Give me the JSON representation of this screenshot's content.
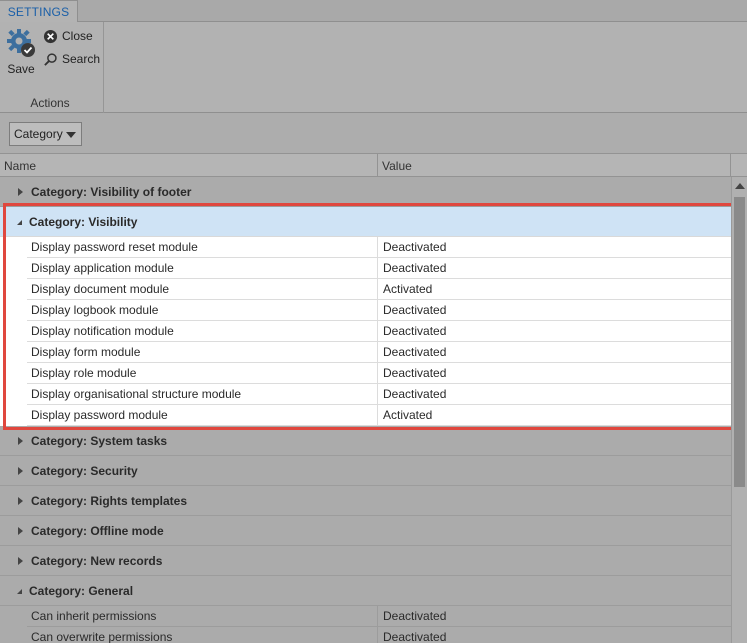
{
  "ribbon": {
    "tab_label": "SETTINGS",
    "save_label": "Save",
    "close_label": "Close",
    "search_label": "Search",
    "group_label": "Actions"
  },
  "filter": {
    "selected": "Category"
  },
  "grid": {
    "columns": {
      "name": "Name",
      "value": "Value"
    },
    "categories": [
      {
        "label": "Category: Visibility of footer",
        "expanded": false
      },
      {
        "label": "Category: Visibility",
        "expanded": true,
        "rows": [
          {
            "name": "Display password reset module",
            "value": "Deactivated"
          },
          {
            "name": "Display application module",
            "value": "Deactivated"
          },
          {
            "name": "Display document module",
            "value": "Activated"
          },
          {
            "name": "Display logbook module",
            "value": "Deactivated"
          },
          {
            "name": "Display notification module",
            "value": "Deactivated"
          },
          {
            "name": "Display form module",
            "value": "Deactivated"
          },
          {
            "name": "Display role module",
            "value": "Deactivated"
          },
          {
            "name": "Display organisational structure module",
            "value": "Deactivated"
          },
          {
            "name": "Display password module",
            "value": "Activated"
          }
        ]
      },
      {
        "label": "Category: System tasks",
        "expanded": false
      },
      {
        "label": "Category: Security",
        "expanded": false
      },
      {
        "label": "Category: Rights templates",
        "expanded": false
      },
      {
        "label": "Category: Offline mode",
        "expanded": false
      },
      {
        "label": "Category: New records",
        "expanded": false
      },
      {
        "label": "Category: General",
        "expanded": true,
        "rows": [
          {
            "name": "Can inherit permissions",
            "value": "Deactivated"
          },
          {
            "name": "Can overwrite permissions",
            "value": "Deactivated"
          }
        ]
      }
    ]
  },
  "colors": {
    "highlight_frame": "#e0473e",
    "selected_category": "#cfe3f5",
    "tab_text": "#1a5fa8"
  }
}
